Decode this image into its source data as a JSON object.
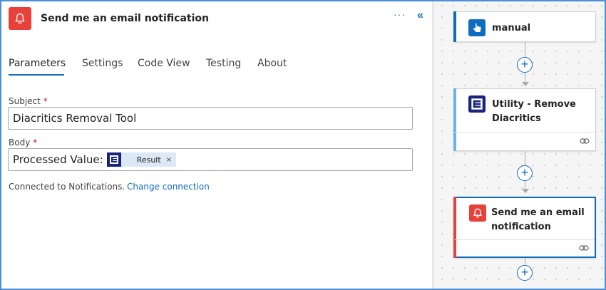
{
  "panel": {
    "title": "Send me an email notification",
    "more_label": "···",
    "collapse_label": "«",
    "tabs": [
      {
        "label": "Parameters",
        "active": true
      },
      {
        "label": "Settings",
        "active": false
      },
      {
        "label": "Code View",
        "active": false
      },
      {
        "label": "Testing",
        "active": false
      },
      {
        "label": "About",
        "active": false
      }
    ],
    "subject": {
      "label": "Subject",
      "required_mark": "*",
      "value": "Diacritics Removal Tool"
    },
    "body": {
      "label": "Body",
      "required_mark": "*",
      "prefix": "Processed Value:",
      "token_label": "Result",
      "token_remove": "×"
    },
    "connection": {
      "text": "Connected to Notifications.",
      "link": "Change connection"
    }
  },
  "flow": {
    "cards": [
      {
        "title": "manual",
        "icon": "touch-icon",
        "accent": "#0f6cbd"
      },
      {
        "title_line1": "Utility - Remove",
        "title_line2": "Diacritics",
        "icon": "utility-icon",
        "accent": "#0f6cbd"
      },
      {
        "title_line1": "Send me an email",
        "title_line2": "notification",
        "icon": "bell-icon",
        "accent": "#e8413a"
      }
    ],
    "add_label": "+"
  },
  "colors": {
    "accent": "#0f6cbd",
    "notification_red": "#e8413a",
    "utility_navy": "#1a237e"
  }
}
